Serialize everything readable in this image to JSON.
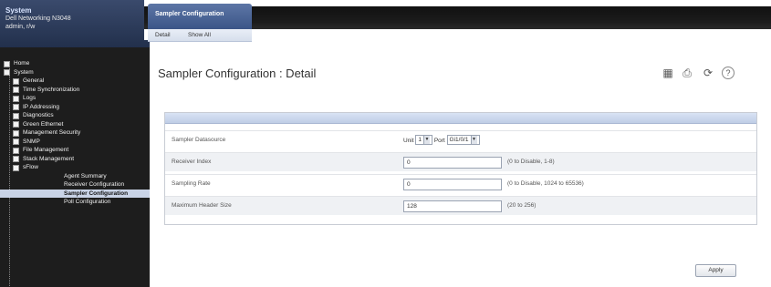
{
  "header": {
    "title": "System",
    "line1": "Dell Networking N3048",
    "line2": "admin, r/w"
  },
  "nav": [
    {
      "label": "Home",
      "indent": 0
    },
    {
      "label": "System",
      "indent": 0
    },
    {
      "label": "General",
      "indent": 1
    },
    {
      "label": "Time Synchronization",
      "indent": 1
    },
    {
      "label": "Logs",
      "indent": 1
    },
    {
      "label": "IP Addressing",
      "indent": 1
    },
    {
      "label": "Diagnostics",
      "indent": 1
    },
    {
      "label": "Green Ethernet",
      "indent": 1
    },
    {
      "label": "Management Security",
      "indent": 1
    },
    {
      "label": "SNMP",
      "indent": 1
    },
    {
      "label": "File Management",
      "indent": 1
    },
    {
      "label": "Stack Management",
      "indent": 1
    },
    {
      "label": "sFlow",
      "indent": 1
    },
    {
      "label": "Agent Summary",
      "indent": 2
    },
    {
      "label": "Receiver Configuration",
      "indent": 2
    },
    {
      "label": "Sampler Configuration",
      "indent": 2,
      "selected": true
    },
    {
      "label": "Poll Configuration",
      "indent": 2
    }
  ],
  "tabs": {
    "main": "Sampler Configuration",
    "sub": [
      "Detail",
      "Show All"
    ]
  },
  "page": {
    "title": "Sampler Configuration : Detail"
  },
  "toolbar_icons": [
    "save-icon",
    "print-icon",
    "refresh-icon",
    "help-icon"
  ],
  "form": {
    "datasource": {
      "label": "Sampler Datasource",
      "unit_label": "Unit",
      "unit_value": "1",
      "port_label": "Port",
      "port_value": "Gi1/0/1"
    },
    "receiver_index": {
      "label": "Receiver Index",
      "value": "0",
      "range": "(0 to Disable, 1-8)"
    },
    "sampling_rate": {
      "label": "Sampling Rate",
      "value": "0",
      "range": "(0 to Disable, 1024 to 65536)"
    },
    "max_header_size": {
      "label": "Maximum Header Size",
      "value": "128",
      "range": "(20 to 256)"
    }
  },
  "apply_label": "Apply",
  "colors": {
    "sidebar_bg": "#1d1d1d",
    "tab_blue": "#3b5587",
    "panel_head": "#c7d4ea"
  }
}
